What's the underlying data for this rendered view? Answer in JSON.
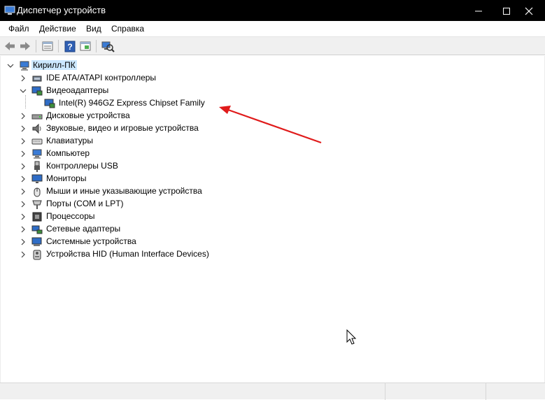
{
  "window": {
    "title": "Диспетчер устройств",
    "controls": {
      "minimize": "—",
      "maximize": "☐",
      "close": "✕"
    }
  },
  "menu": [
    "Файл",
    "Действие",
    "Вид",
    "Справка"
  ],
  "toolbar": {
    "buttons": [
      "back-arrow-icon",
      "forward-arrow-icon",
      "properties-sheet-icon",
      "help-icon",
      "view-panel-icon",
      "scan-hardware-icon"
    ]
  },
  "tree": {
    "root": {
      "label": "Кирилл-ПК",
      "icon": "computer-icon",
      "expanded": true
    },
    "categories": [
      {
        "label": "IDE ATA/ATAPI контроллеры",
        "icon": "ide-controller-icon",
        "expanded": false
      },
      {
        "label": "Видеоадаптеры",
        "icon": "display-adapter-icon",
        "expanded": true,
        "children": [
          {
            "label": "Intel(R)  946GZ Express Chipset Family",
            "icon": "display-adapter-icon"
          }
        ]
      },
      {
        "label": "Дисковые устройства",
        "icon": "disk-drive-icon",
        "expanded": false
      },
      {
        "label": "Звуковые, видео и игровые устройства",
        "icon": "speaker-icon",
        "expanded": false
      },
      {
        "label": "Клавиатуры",
        "icon": "keyboard-icon",
        "expanded": false
      },
      {
        "label": "Компьютер",
        "icon": "computer-icon",
        "expanded": false
      },
      {
        "label": "Контроллеры USB",
        "icon": "usb-icon",
        "expanded": false
      },
      {
        "label": "Мониторы",
        "icon": "monitor-icon",
        "expanded": false
      },
      {
        "label": "Мыши и иные указывающие устройства",
        "icon": "mouse-icon",
        "expanded": false
      },
      {
        "label": "Порты (COM и LPT)",
        "icon": "port-icon",
        "expanded": false
      },
      {
        "label": "Процессоры",
        "icon": "processor-icon",
        "expanded": false
      },
      {
        "label": "Сетевые адаптеры",
        "icon": "network-adapter-icon",
        "expanded": false
      },
      {
        "label": "Системные устройства",
        "icon": "system-device-icon",
        "expanded": false
      },
      {
        "label": "Устройства HID (Human Interface Devices)",
        "icon": "hid-icon",
        "expanded": false
      }
    ]
  },
  "annotation": {
    "arrow_color": "#e01b1b"
  }
}
